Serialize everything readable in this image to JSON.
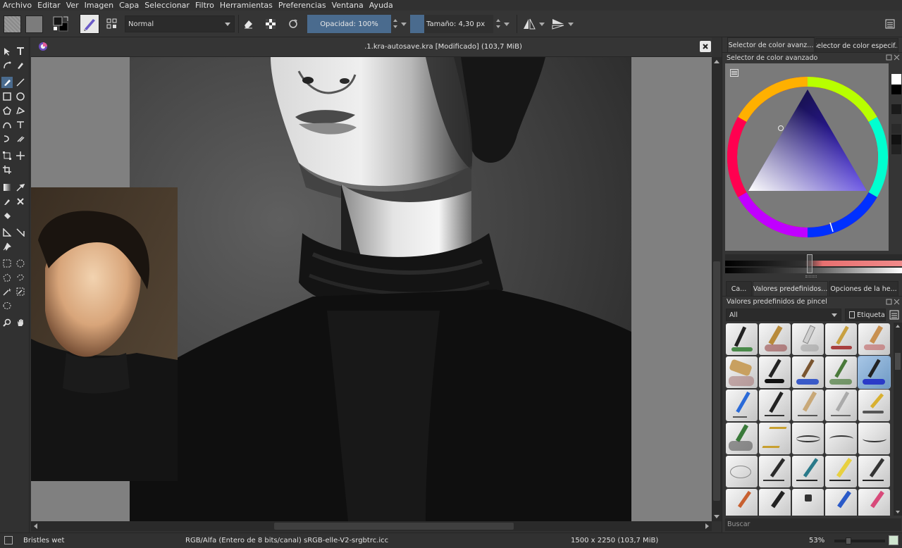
{
  "menu": [
    "Archivo",
    "Editar",
    "Ver",
    "Imagen",
    "Capa",
    "Seleccionar",
    "Filtro",
    "Herramientas",
    "Preferencias",
    "Ventana",
    "Ayuda"
  ],
  "toolbar": {
    "blend_mode": "Normal",
    "opacity_label": "Opacidad:",
    "opacity_value": "100%",
    "opacity_fraction": 1.0,
    "size_label": "Tamaño:",
    "size_value": "4,30 px"
  },
  "document": {
    "title": ".1.kra-autosave.kra [Modificado]  (103,7 MiB)"
  },
  "right_panel": {
    "top_tabs": [
      "Selector de color avanz...",
      "Selector de color especif..."
    ],
    "color_selector_title": "Selector de color avanzado",
    "mid_tabs": [
      "Ca...",
      "Valores predefinidos...",
      "Opciones de la he..."
    ],
    "presets_title": "Valores predefinidos de pincel",
    "filter_value": "All",
    "tag_label": "Etiqueta",
    "search_placeholder": "Buscar",
    "accent_color": "#4a6b8e"
  },
  "status": {
    "brush_name": "Bristles wet",
    "color_space": "RGB/Alfa (Entero de 8 bits/canal)  sRGB-elle-V2-srgbtrc.icc",
    "dimensions": "1500 x 2250 (103,7 MiB)",
    "zoom": "53%"
  }
}
